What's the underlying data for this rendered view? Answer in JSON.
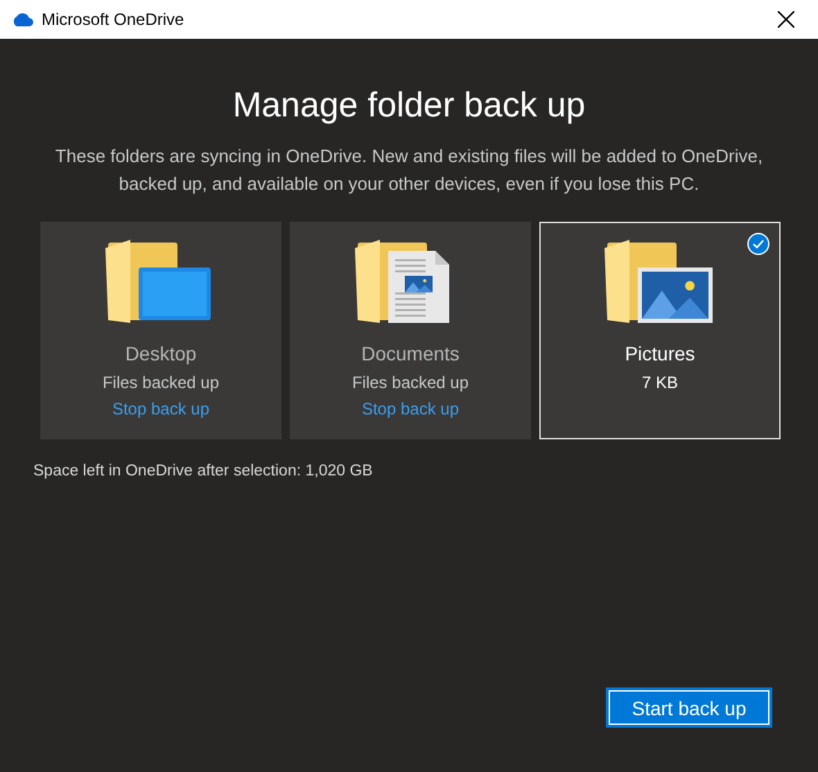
{
  "window": {
    "title": "Microsoft OneDrive"
  },
  "heading": "Manage folder back up",
  "description": "These folders are syncing in OneDrive. New and existing files will be added to OneDrive, backed up, and available on your other devices, even if you lose this PC.",
  "folders": [
    {
      "kind": "desktop",
      "name": "Desktop",
      "status": "Files backed up",
      "action": "Stop back up",
      "selected": false
    },
    {
      "kind": "documents",
      "name": "Documents",
      "status": "Files backed up",
      "action": "Stop back up",
      "selected": false
    },
    {
      "kind": "pictures",
      "name": "Pictures",
      "status": "7 KB",
      "selected": true
    }
  ],
  "space_note": "Space left in OneDrive after selection: 1,020 GB",
  "primary_button": "Start back up"
}
